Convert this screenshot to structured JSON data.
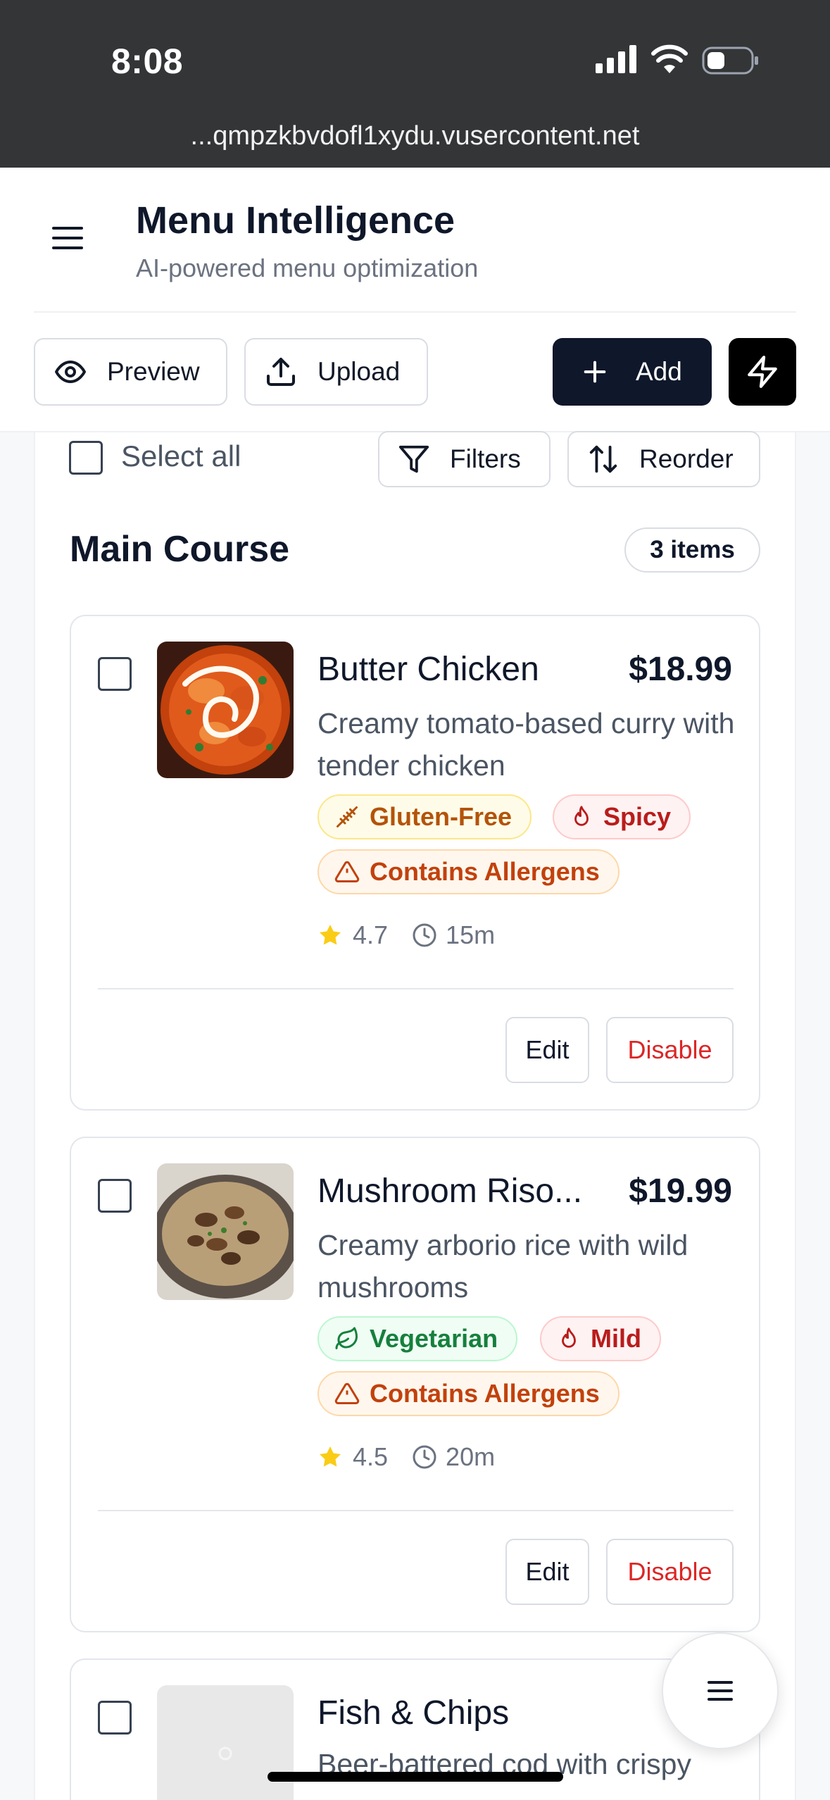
{
  "status_bar": {
    "time": "8:08",
    "url": "...qmpzkbvdofl1xydu.vusercontent.net"
  },
  "header": {
    "title": "Menu Intelligence",
    "subtitle": "AI-powered menu optimization",
    "preview_label": "Preview",
    "upload_label": "Upload",
    "add_label": "Add"
  },
  "toolbar": {
    "select_all_label": "Select all",
    "filters_label": "Filters",
    "reorder_label": "Reorder"
  },
  "section": {
    "title": "Main Course",
    "count": "3 items"
  },
  "items": [
    {
      "name": "Butter Chicken",
      "price": "$18.99",
      "description": "Creamy tomato-based curry with tender chicken",
      "tags": [
        "Gluten-Free",
        "Spicy",
        "Contains Allergens"
      ],
      "rating": "4.7",
      "prep_time": "15m",
      "edit_label": "Edit",
      "disable_label": "Disable"
    },
    {
      "name": "Mushroom Riso...",
      "price": "$19.99",
      "description": "Creamy arborio rice with wild mushrooms",
      "tags": [
        "Vegetarian",
        "Mild",
        "Contains Allergens"
      ],
      "rating": "4.5",
      "prep_time": "20m",
      "edit_label": "Edit",
      "disable_label": "Disable"
    },
    {
      "name": "Fish & Chips",
      "price": "$1",
      "description": "Beer-battered cod with crispy"
    }
  ],
  "colors": {
    "primary": "#0f172a",
    "danger": "#dc2626",
    "star": "#facc15",
    "status_bar": "#333537"
  }
}
